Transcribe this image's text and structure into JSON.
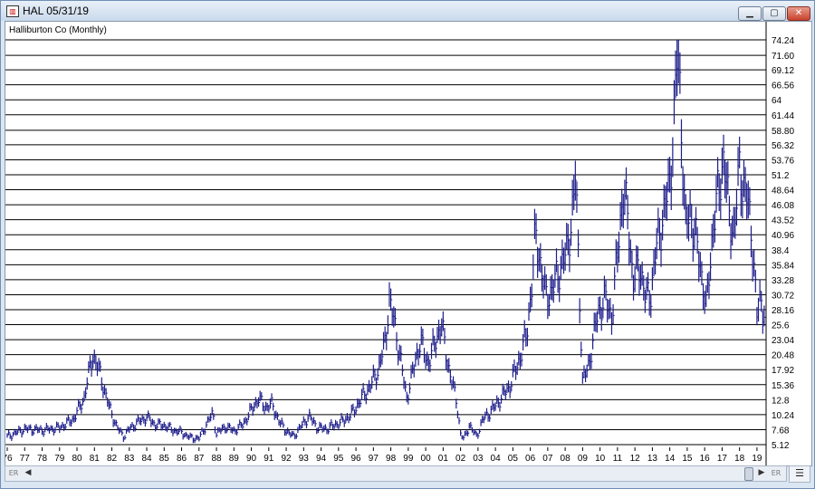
{
  "window": {
    "title": "HAL 05/31/19",
    "icon": "chart-app-icon",
    "controls": [
      "minimize-icon",
      "maximize-icon",
      "close-icon"
    ]
  },
  "scrollbar": {
    "left_label": "ER",
    "right_label": "ER",
    "menu_icon": "menu-lines-icon"
  },
  "colors": {
    "price_bars": "#1e1e8c",
    "gridlines": "#000000",
    "background": "#ffffff"
  },
  "chart_data": {
    "type": "bar",
    "subtype": "ohlc-monthly",
    "title": "Halliburton Co (Monthly)",
    "xlabel": "",
    "ylabel": "",
    "grid": true,
    "y_axis_position": "right",
    "ylim": [
      5.12,
      74.24
    ],
    "y_ticks": [
      "74.24",
      "71.60",
      "69.12",
      "66.56",
      "64",
      "61.44",
      "58.80",
      "56.32",
      "53.76",
      "51.2",
      "48.64",
      "46.08",
      "43.52",
      "40.96",
      "38.4",
      "35.84",
      "33.28",
      "30.72",
      "28.16",
      "25.6",
      "23.04",
      "20.48",
      "17.92",
      "15.36",
      "12.8",
      "10.24",
      "7.68",
      "5.12"
    ],
    "x_ticks": [
      "76",
      "77",
      "78",
      "79",
      "80",
      "81",
      "82",
      "83",
      "84",
      "85",
      "86",
      "87",
      "88",
      "89",
      "90",
      "91",
      "92",
      "93",
      "94",
      "95",
      "96",
      "97",
      "98",
      "99",
      "00",
      "01",
      "02",
      "03",
      "04",
      "05",
      "06",
      "07",
      "08",
      "09",
      "10",
      "11",
      "12",
      "13",
      "14",
      "15",
      "16",
      "17",
      "18",
      "19"
    ],
    "x_start": 1976.0,
    "x_end": 2019.42,
    "series": [
      {
        "points": [
          [
            1976.0,
            6.5
          ],
          [
            1977.0,
            7.8
          ],
          [
            1978.0,
            7.6
          ],
          [
            1979.0,
            8.0
          ],
          [
            1979.8,
            9.5
          ],
          [
            1980.4,
            13
          ],
          [
            1980.9,
            20.5
          ],
          [
            1981.3,
            17.5
          ],
          [
            1981.8,
            12
          ],
          [
            1982.3,
            8
          ],
          [
            1982.7,
            6.5
          ],
          [
            1983.0,
            7.8
          ],
          [
            1983.5,
            9
          ],
          [
            1984.0,
            9.8
          ],
          [
            1984.5,
            8.5
          ],
          [
            1985.0,
            8.4
          ],
          [
            1985.5,
            7.6
          ],
          [
            1986.0,
            7.2
          ],
          [
            1986.5,
            6.3
          ],
          [
            1987.0,
            6.2
          ],
          [
            1987.5,
            9
          ],
          [
            1987.8,
            10.5
          ],
          [
            1988.0,
            7
          ],
          [
            1988.5,
            8.2
          ],
          [
            1989.0,
            7.5
          ],
          [
            1989.5,
            8.5
          ],
          [
            1990.0,
            11
          ],
          [
            1990.4,
            13
          ],
          [
            1990.8,
            11.5
          ],
          [
            1991.2,
            12
          ],
          [
            1991.6,
            9
          ],
          [
            1992.0,
            7.5
          ],
          [
            1992.4,
            6.5
          ],
          [
            1992.8,
            8
          ],
          [
            1993.3,
            10
          ],
          [
            1993.8,
            8
          ],
          [
            1994.3,
            7.8
          ],
          [
            1994.8,
            8.5
          ],
          [
            1995.3,
            9.2
          ],
          [
            1995.8,
            10.5
          ],
          [
            1996.3,
            13
          ],
          [
            1996.8,
            15
          ],
          [
            1997.3,
            18
          ],
          [
            1997.7,
            23
          ],
          [
            1997.9,
            30
          ],
          [
            1998.2,
            26
          ],
          [
            1998.6,
            19
          ],
          [
            1998.9,
            13
          ],
          [
            1999.3,
            18
          ],
          [
            1999.7,
            23
          ],
          [
            2000.1,
            19
          ],
          [
            2000.5,
            22
          ],
          [
            2000.9,
            26
          ],
          [
            2001.2,
            20
          ],
          [
            2001.5,
            16
          ],
          [
            2001.8,
            12
          ],
          [
            2002.0,
            7
          ],
          [
            2002.2,
            6
          ],
          [
            2002.5,
            8.5
          ],
          [
            2002.9,
            6.5
          ],
          [
            2003.3,
            9.5
          ],
          [
            2003.8,
            11
          ],
          [
            2004.3,
            13
          ],
          [
            2004.8,
            15
          ],
          [
            2005.3,
            19
          ],
          [
            2005.8,
            24
          ],
          [
            2006.1,
            33
          ],
          [
            2006.3,
            41
          ],
          [
            2006.6,
            36
          ],
          [
            2006.9,
            30
          ],
          [
            2007.3,
            32
          ],
          [
            2007.8,
            36
          ],
          [
            2008.1,
            38
          ],
          [
            2008.5,
            47
          ],
          [
            2008.6,
            52
          ],
          [
            2008.8,
            33
          ],
          [
            2009.0,
            16
          ],
          [
            2009.3,
            18
          ],
          [
            2009.6,
            23
          ],
          [
            2009.9,
            28
          ],
          [
            2010.3,
            30
          ],
          [
            2010.7,
            27
          ],
          [
            2011.0,
            38
          ],
          [
            2011.3,
            48
          ],
          [
            2011.6,
            44
          ],
          [
            2011.9,
            33
          ],
          [
            2012.3,
            36
          ],
          [
            2012.6,
            30
          ],
          [
            2012.9,
            31
          ],
          [
            2013.3,
            40
          ],
          [
            2013.7,
            45
          ],
          [
            2014.0,
            50
          ],
          [
            2014.3,
            63
          ],
          [
            2014.45,
            73
          ],
          [
            2014.6,
            65
          ],
          [
            2014.9,
            42
          ],
          [
            2015.2,
            45
          ],
          [
            2015.5,
            40
          ],
          [
            2015.9,
            33
          ],
          [
            2016.1,
            28
          ],
          [
            2016.5,
            43
          ],
          [
            2016.9,
            50
          ],
          [
            2017.1,
            55
          ],
          [
            2017.4,
            44
          ],
          [
            2017.7,
            42
          ],
          [
            2018.0,
            52
          ],
          [
            2018.4,
            48
          ],
          [
            2018.8,
            38
          ],
          [
            2019.0,
            27
          ],
          [
            2019.2,
            30
          ],
          [
            2019.42,
            28
          ]
        ]
      }
    ]
  }
}
